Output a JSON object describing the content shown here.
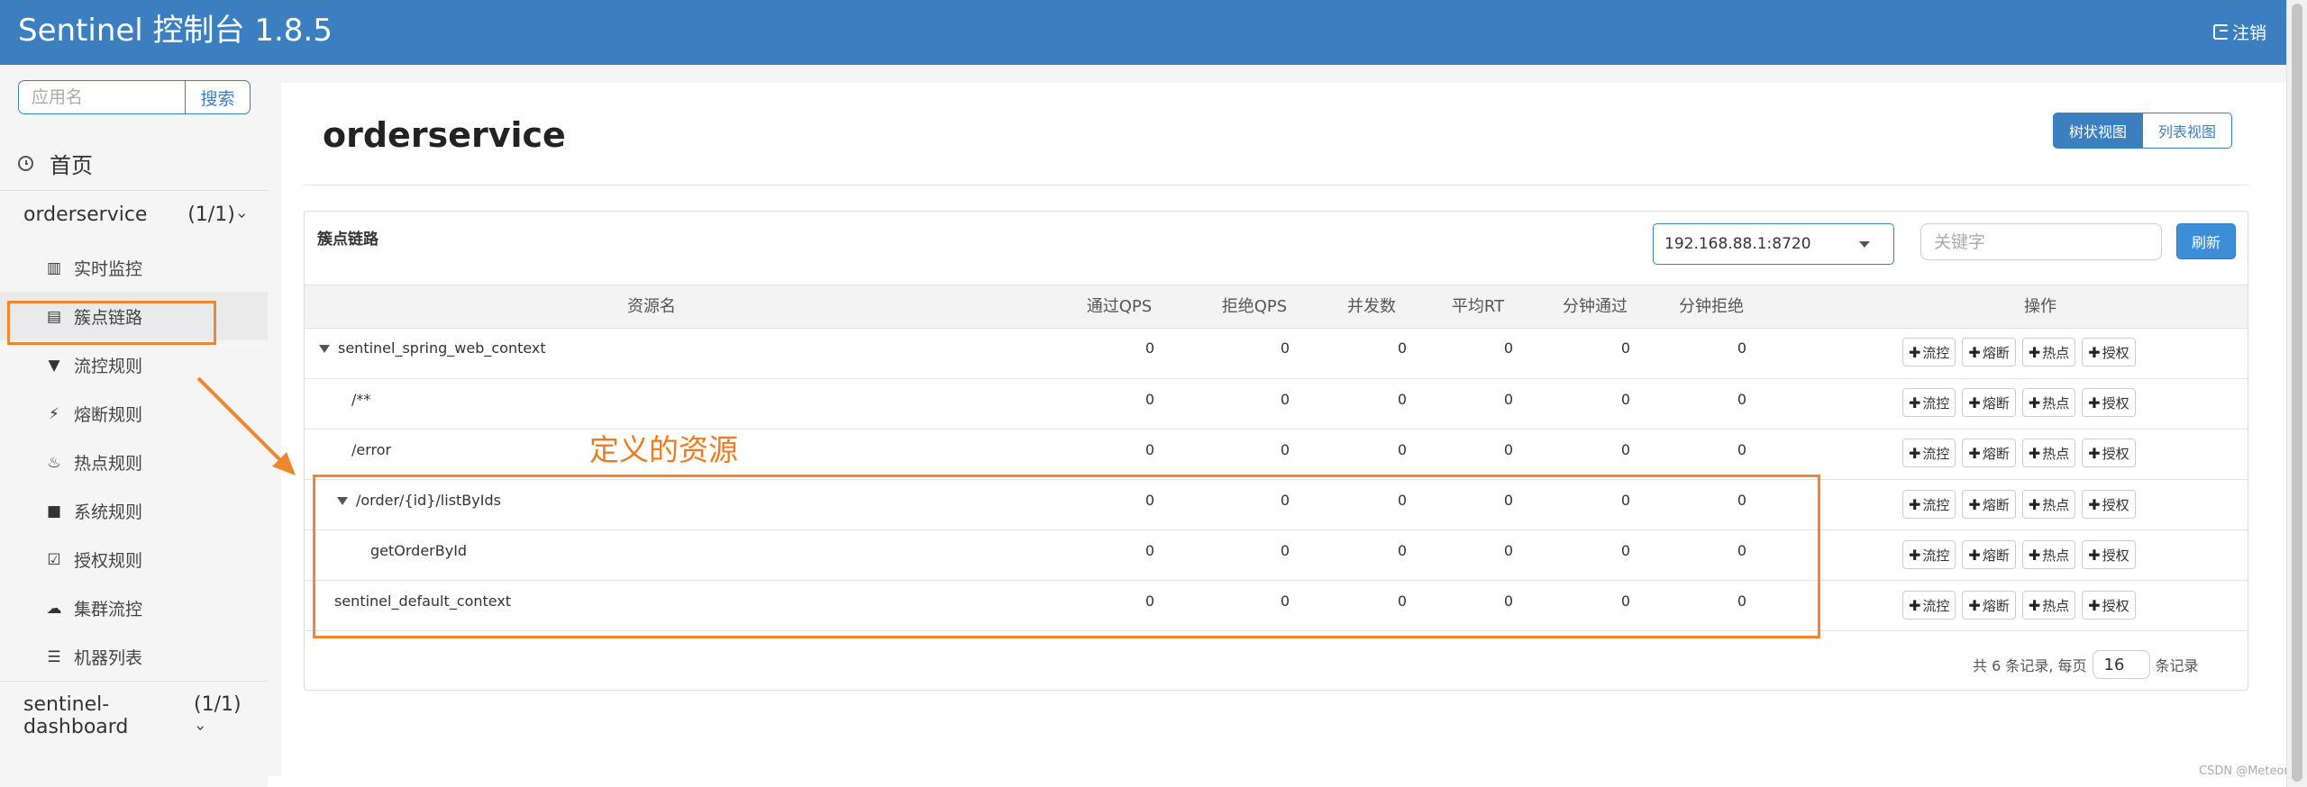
{
  "header": {
    "brand": "Sentinel 控制台 1.8.5",
    "logout_label": "注销"
  },
  "sidebar": {
    "search_placeholder": "应用名",
    "search_button": "搜索",
    "home_label": "首页",
    "apps": [
      {
        "name": "orderservice",
        "count": "(1/1)"
      },
      {
        "name": "sentinel-dashboard",
        "count": "(1/1)"
      }
    ],
    "menu": [
      {
        "label": "实时监控",
        "icon": "bar-chart-icon"
      },
      {
        "label": "簇点链路",
        "icon": "list-alt-icon"
      },
      {
        "label": "流控规则",
        "icon": "filter-icon"
      },
      {
        "label": "熔断规则",
        "icon": "flash-icon"
      },
      {
        "label": "热点规则",
        "icon": "fire-icon"
      },
      {
        "label": "系统规则",
        "icon": "lock-icon"
      },
      {
        "label": "授权规则",
        "icon": "check-icon"
      },
      {
        "label": "集群流控",
        "icon": "cloud-icon"
      },
      {
        "label": "机器列表",
        "icon": "th-list-icon"
      }
    ]
  },
  "main": {
    "title": "orderservice",
    "view_buttons": {
      "tree": "树状视图",
      "list": "列表视图"
    },
    "panel_title": "簇点链路",
    "machine_select": "192.168.88.1:8720",
    "keyword_placeholder": "关键字",
    "refresh_button": "刷新"
  },
  "table": {
    "columns": [
      "资源名",
      "通过QPS",
      "拒绝QPS",
      "并发数",
      "平均RT",
      "分钟通过",
      "分钟拒绝",
      "操作"
    ],
    "op_buttons": [
      "流控",
      "熔断",
      "热点",
      "授权"
    ],
    "rows": [
      {
        "name": "sentinel_spring_web_context",
        "expand": true,
        "values": [
          "0",
          "0",
          "0",
          "0",
          "0",
          "0"
        ]
      },
      {
        "name": "/**",
        "expand": false,
        "values": [
          "0",
          "0",
          "0",
          "0",
          "0",
          "0"
        ]
      },
      {
        "name": "/error",
        "expand": false,
        "values": [
          "0",
          "0",
          "0",
          "0",
          "0",
          "0"
        ]
      },
      {
        "name": "/order/{id}/listByIds",
        "expand": true,
        "values": [
          "0",
          "0",
          "0",
          "0",
          "0",
          "0"
        ]
      },
      {
        "name": "getOrderById",
        "expand": false,
        "values": [
          "0",
          "0",
          "0",
          "0",
          "0",
          "0"
        ]
      },
      {
        "name": "sentinel_default_context",
        "expand": false,
        "values": [
          "0",
          "0",
          "0",
          "0",
          "0",
          "0"
        ]
      }
    ]
  },
  "pagination": {
    "prefix": "共 6 条记录, 每页",
    "page_size": "16",
    "suffix": "条记录"
  },
  "annotation": {
    "label": "定义的资源"
  },
  "watermark": "CSDN @Meteors."
}
